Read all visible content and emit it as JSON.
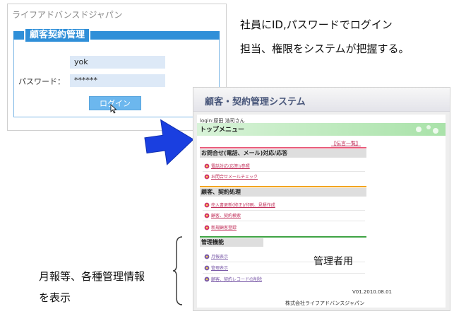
{
  "login": {
    "company": "ライフアドバンスドジャパン",
    "title": "顧客契約管理",
    "id_value": "yok",
    "password_label": "パスワード：",
    "password_value": "******",
    "button_label": "ログイン"
  },
  "captions": {
    "login_line1": "社員にID,パスワードでログイン",
    "login_line2": "担当、権限をシステムが把握する。",
    "admin_line1": "月報等、各種管理情報",
    "admin_line2": "を表示"
  },
  "system": {
    "title": "顧客・契約管理システム",
    "login_user": "login:原田 浩司さん",
    "top_menu": "トップメニュー",
    "message_link": "【伝言一覧】",
    "sections": [
      {
        "heading": "お問合せ(電話、メール)対応/応答",
        "items": [
          "電話対応(応答)/参照",
          "お問合せメールチェック"
        ]
      },
      {
        "heading": "顧客、契約処理",
        "items": [
          "売入書更新(修正)/印刷、見積作成",
          "顧客、契約検索",
          "新規顧客登録"
        ]
      },
      {
        "heading": "管理機能",
        "items": [
          "月報表示",
          "管理表示",
          "顧客、契約レコードの削除"
        ]
      }
    ],
    "admin_label": "管理者用",
    "version": "V01.2010.08.01",
    "footer_company": "株式会社ライフアドバンスジャパン"
  },
  "colors": {
    "login_blue": "#2f8fd8",
    "arrow_blue": "#1a3fe0",
    "link_red": "#c0305a",
    "admin_purple": "#7a5aa8"
  }
}
